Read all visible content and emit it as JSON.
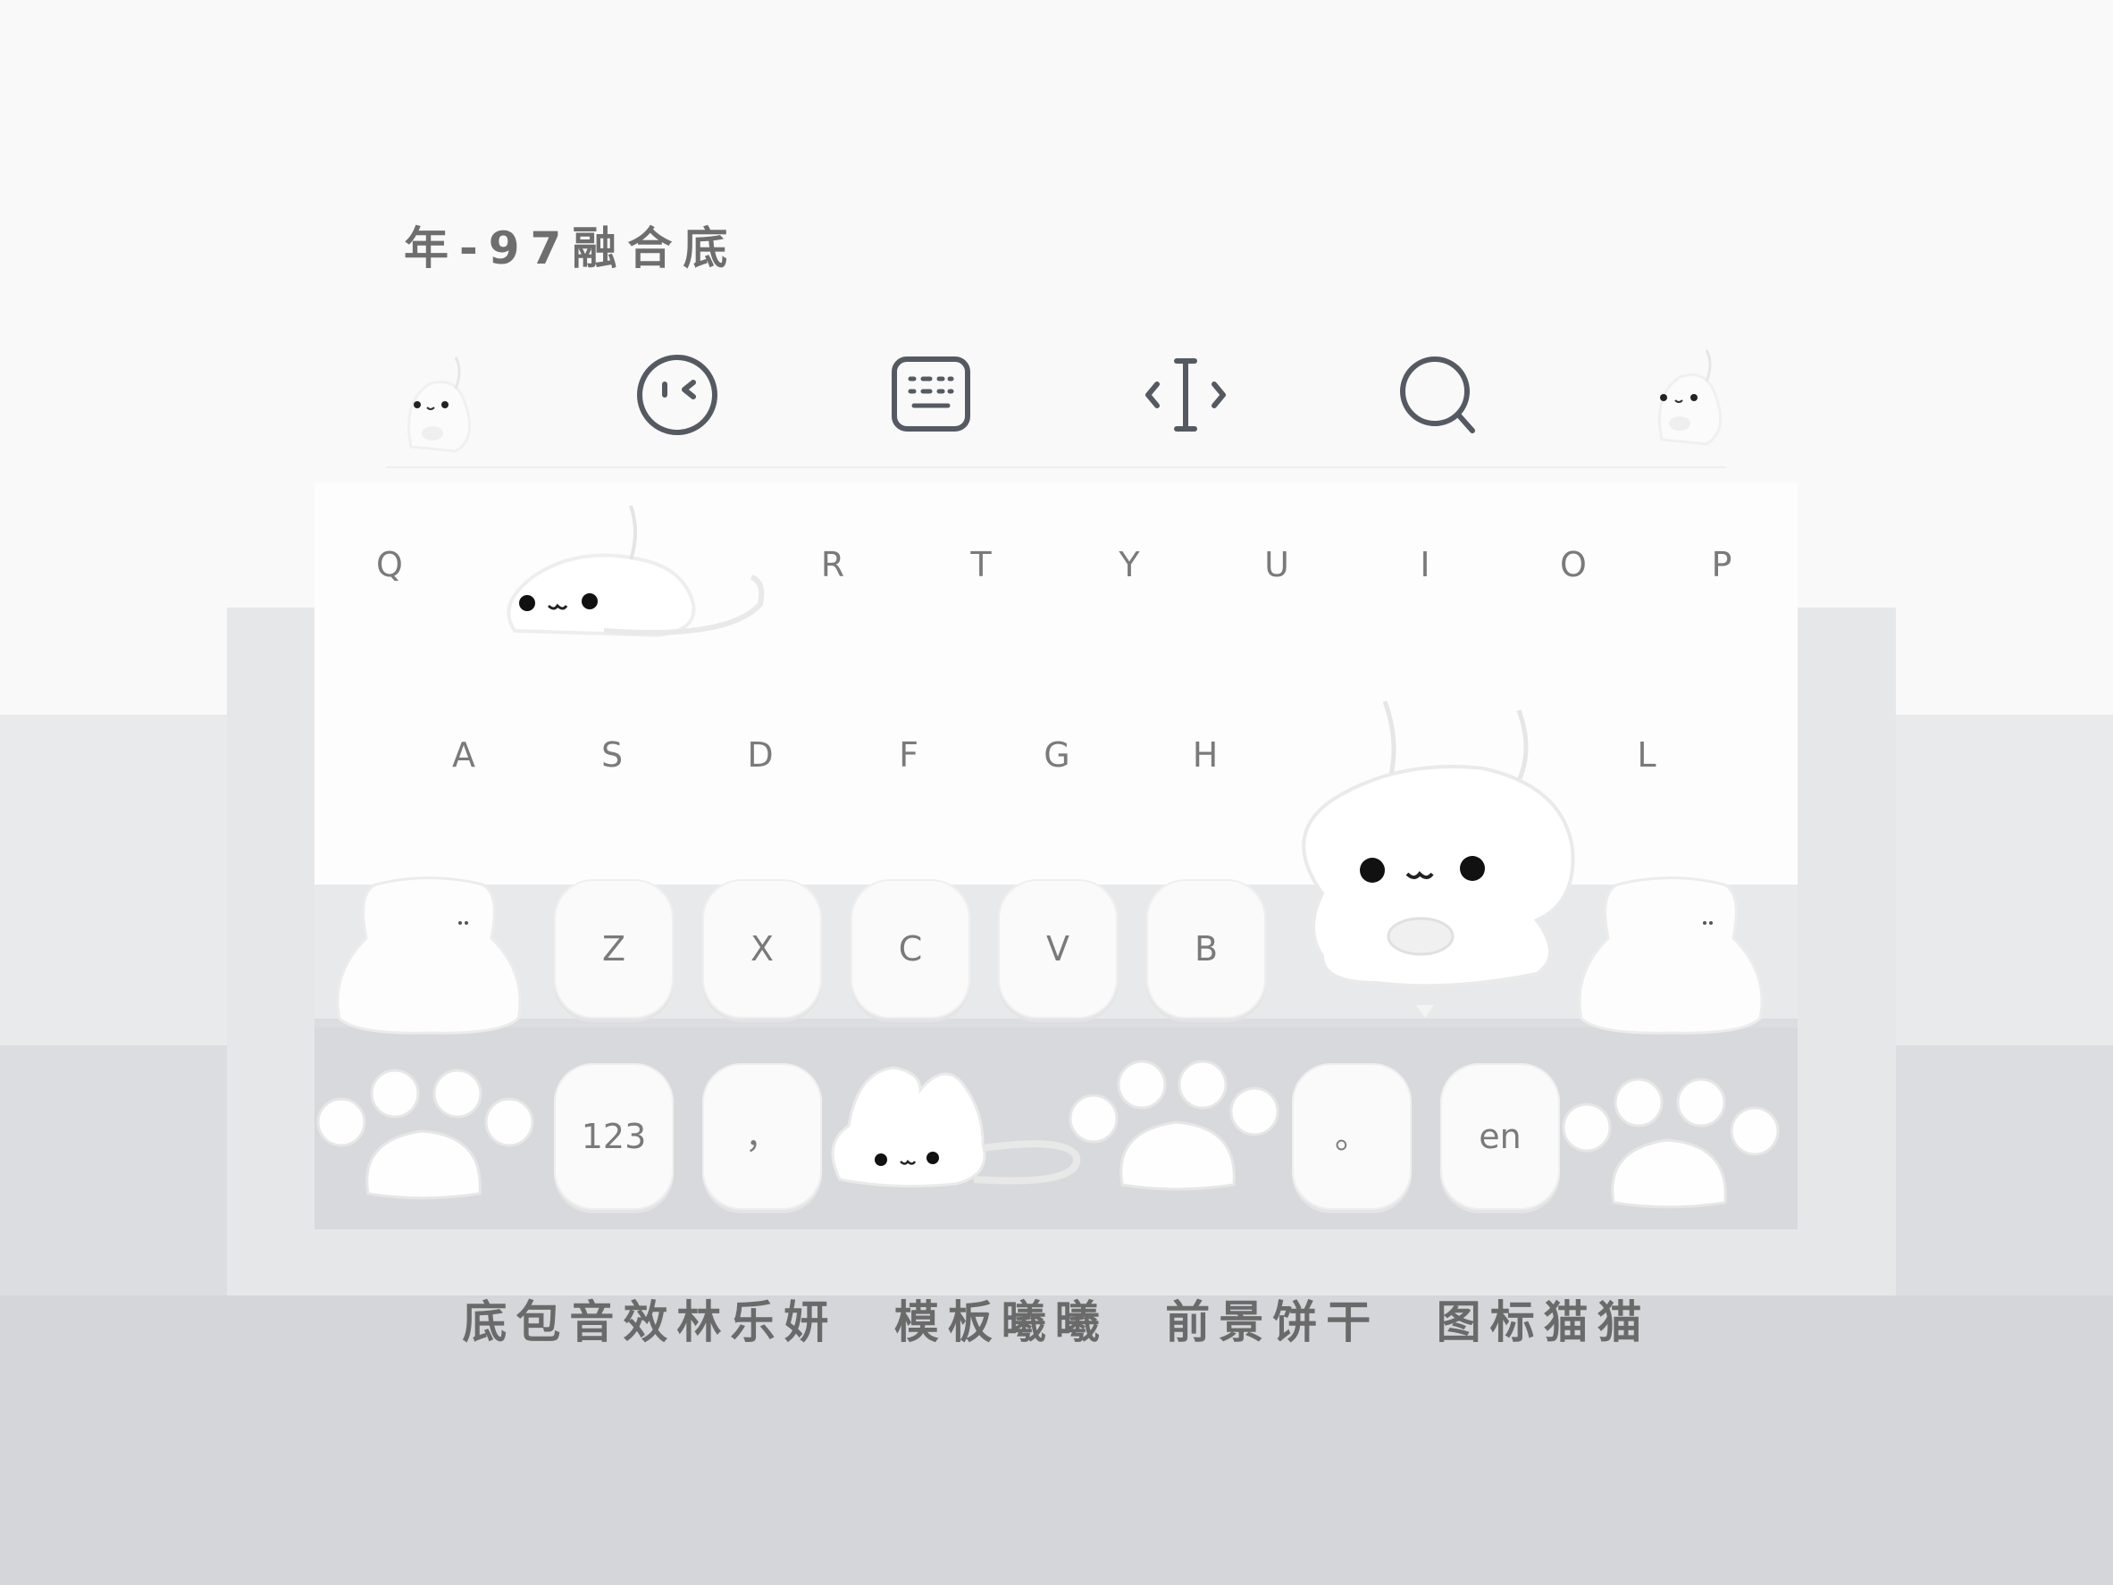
{
  "title": "年-97融合底",
  "toolbar": {
    "icons": [
      "cat-mascot-icon",
      "emoji-face-icon",
      "keyboard-icon",
      "cursor-move-icon",
      "search-icon",
      "cat-mascot-icon"
    ]
  },
  "keyboard": {
    "row1": [
      "Q",
      "R",
      "T",
      "Y",
      "U",
      "I",
      "O",
      "P"
    ],
    "row2": [
      "A",
      "S",
      "D",
      "F",
      "G",
      "H",
      "L"
    ],
    "row3": [
      "Z",
      "X",
      "C",
      "V",
      "B"
    ],
    "row4": {
      "numbers_label": "123",
      "comma_label": "，",
      "period_label": "。",
      "lang_label": "en"
    }
  },
  "credits": [
    "底包音效林乐妍",
    "模板曦曦",
    "前景饼干",
    "图标猫猫"
  ],
  "colors": {
    "background_top": "#f9f9f9",
    "background_bottom": "#d4d6da",
    "key_fill": "#fafafa",
    "text": "#6e6e6e"
  }
}
